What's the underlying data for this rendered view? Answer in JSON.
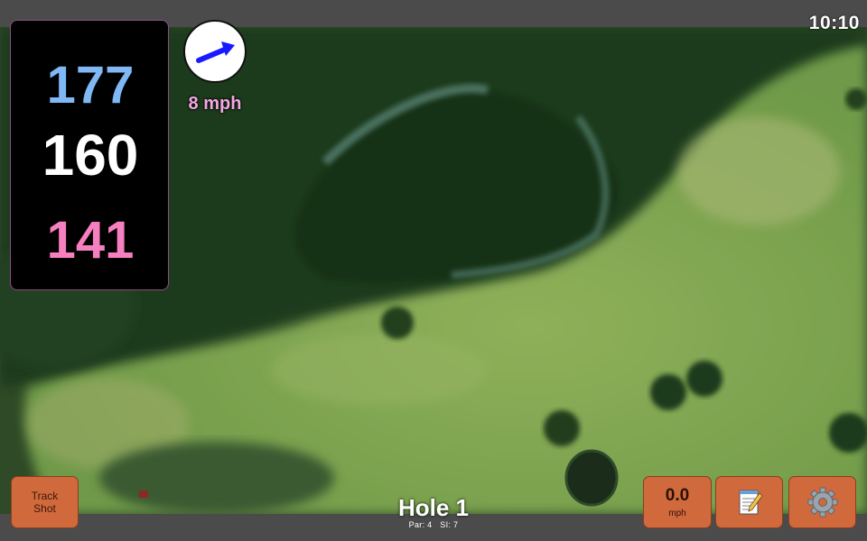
{
  "status": {
    "clock": "10:10"
  },
  "distances": {
    "back": "177",
    "middle": "160",
    "front": "141"
  },
  "wind": {
    "speed": "8 mph",
    "icon": "wind-direction-arrow-icon",
    "arrow_color": "#1a1aff"
  },
  "hole": {
    "title": "Hole 1",
    "par": "Par: 4",
    "si": "SI: 7"
  },
  "buttons": {
    "track_line1": "Track",
    "track_line2": "Shot",
    "speed_value": "0.0",
    "speed_unit": "mph",
    "notes_icon": "notepad-icon",
    "settings_icon": "gear-icon"
  },
  "colors": {
    "back_yardage": "#7fb8f4",
    "middle_yardage": "#ffffff",
    "front_yardage": "#f57fbf",
    "button_bg": "#d0693c",
    "wind_text": "#f3a6e4"
  }
}
